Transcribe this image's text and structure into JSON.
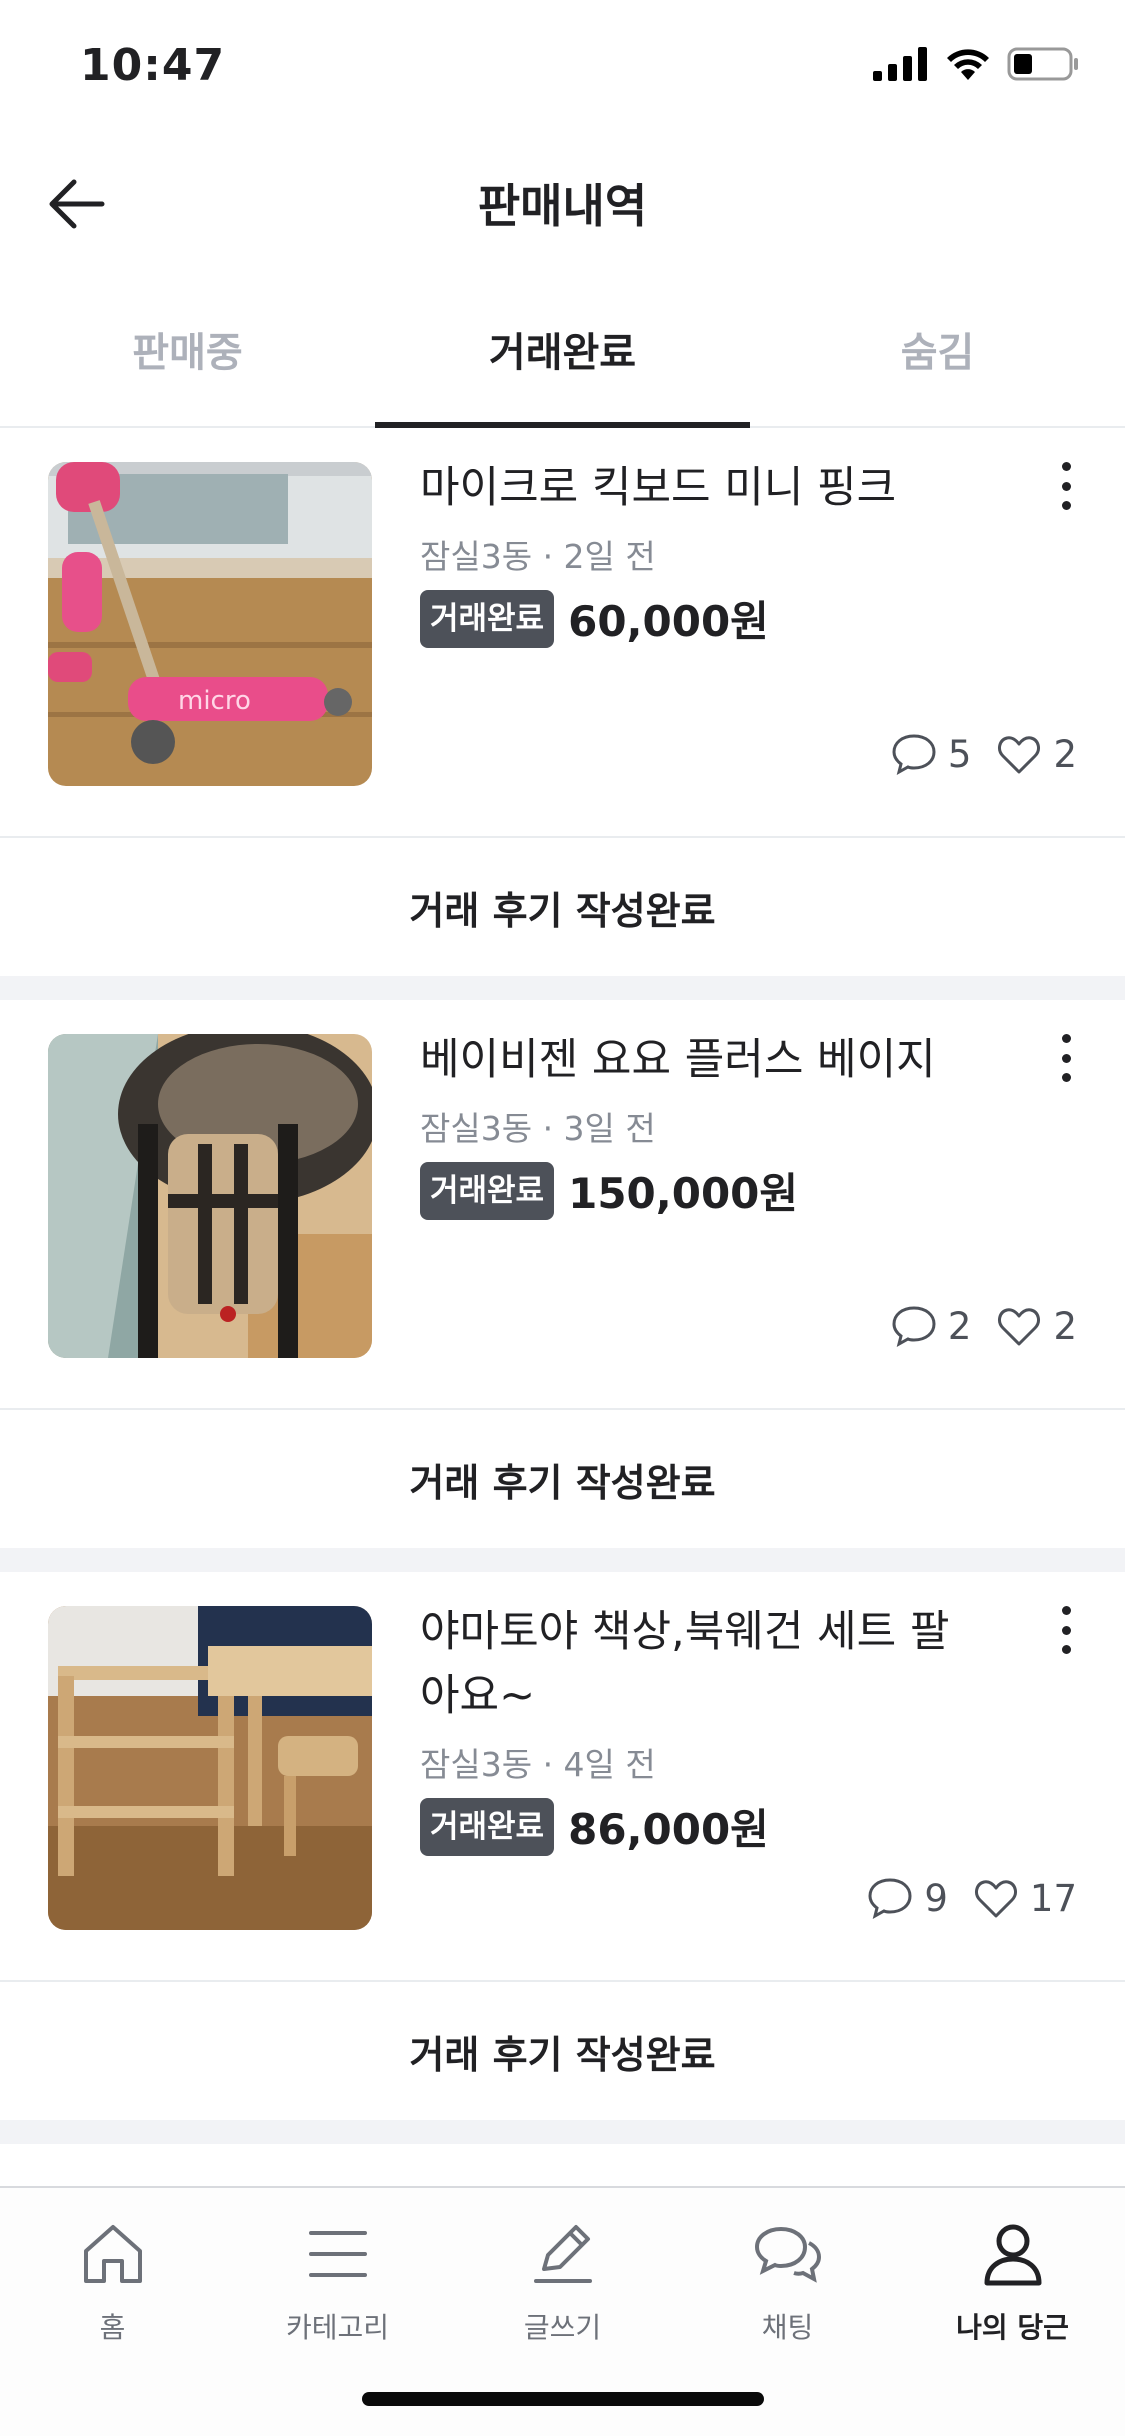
{
  "status_bar": {
    "time": "10:47"
  },
  "header": {
    "title": "판매내역"
  },
  "tabs": [
    {
      "label": "판매중",
      "active": false
    },
    {
      "label": "거래완료",
      "active": true
    },
    {
      "label": "숨김",
      "active": false
    }
  ],
  "items": [
    {
      "title": "마이크로 킥보드 미니 핑크",
      "meta": "잠실3동 · 2일 전",
      "badge": "거래완료",
      "price": "60,000원",
      "chat_count": "5",
      "like_count": "2",
      "review_label": "거래 후기 작성완료",
      "thumbnail": "pink-kick-scooter-photo"
    },
    {
      "title": "베이비젠 요요 플러스 베이지",
      "meta": "잠실3동 · 3일 전",
      "badge": "거래완료",
      "price": "150,000원",
      "chat_count": "2",
      "like_count": "2",
      "review_label": "거래 후기 작성완료",
      "thumbnail": "beige-stroller-photo"
    },
    {
      "title": "야마토야 책상,북웨건 세트 팔아요~",
      "meta": "잠실3동 · 4일 전",
      "badge": "거래완료",
      "price": "86,000원",
      "chat_count": "9",
      "like_count": "17",
      "review_label": "거래 후기 작성완료",
      "thumbnail": "wooden-desk-set-photo"
    }
  ],
  "bottom_nav": [
    {
      "label": "홈",
      "icon": "home-icon",
      "active": false
    },
    {
      "label": "카테고리",
      "icon": "menu-icon",
      "active": false
    },
    {
      "label": "글쓰기",
      "icon": "pencil-icon",
      "active": false
    },
    {
      "label": "채팅",
      "icon": "chat-icon",
      "active": false
    },
    {
      "label": "나의 당근",
      "icon": "person-icon",
      "active": true
    }
  ],
  "colors": {
    "badge": "#4d5159",
    "text": "#212124",
    "muted": "#868b94",
    "divider": "#e9ecef"
  }
}
